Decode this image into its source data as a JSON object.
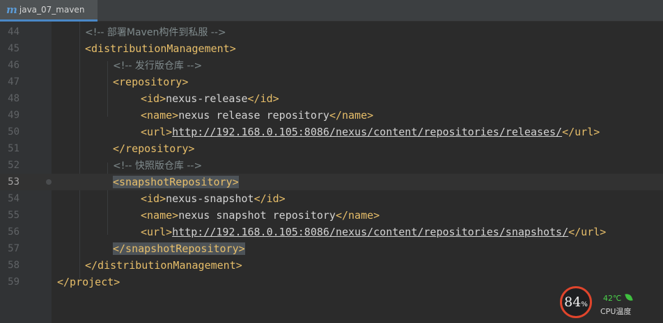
{
  "tab": {
    "icon": "maven-m-icon",
    "icon_glyph": "m",
    "label": "java_07_maven"
  },
  "lines": [
    {
      "n": "44",
      "tokens": [
        {
          "k": "c",
          "v": "<!-- 部署Maven构件到私服 -->"
        }
      ]
    },
    {
      "n": "45",
      "tokens": [
        {
          "k": "t",
          "v": "<distributionManagement>"
        }
      ]
    },
    {
      "n": "46",
      "tokens": [
        {
          "k": "c",
          "v": "<!-- 发行版仓库 -->"
        }
      ]
    },
    {
      "n": "47",
      "tokens": [
        {
          "k": "t",
          "v": "<repository>"
        }
      ]
    },
    {
      "n": "48",
      "tokens": [
        {
          "k": "t",
          "v": "<id>"
        },
        {
          "k": "x",
          "v": "nexus-release"
        },
        {
          "k": "t",
          "v": "</id>"
        }
      ]
    },
    {
      "n": "49",
      "tokens": [
        {
          "k": "t",
          "v": "<name>"
        },
        {
          "k": "x",
          "v": "nexus release repository"
        },
        {
          "k": "t",
          "v": "</name>"
        }
      ]
    },
    {
      "n": "50",
      "tokens": [
        {
          "k": "t",
          "v": "<url>"
        },
        {
          "k": "u",
          "v": "http://192.168.0.105:8086/nexus/content/repositories/releases/"
        },
        {
          "k": "t",
          "v": "</url>"
        }
      ]
    },
    {
      "n": "51",
      "tokens": [
        {
          "k": "t",
          "v": "</repository>"
        }
      ]
    },
    {
      "n": "52",
      "tokens": [
        {
          "k": "c",
          "v": "<!-- 快照版仓库 -->"
        }
      ]
    },
    {
      "n": "53",
      "tokens": [
        {
          "k": "t",
          "v": "<snapshotRepository>",
          "hl": true
        }
      ]
    },
    {
      "n": "54",
      "tokens": [
        {
          "k": "t",
          "v": "<id>"
        },
        {
          "k": "x",
          "v": "nexus-snapshot"
        },
        {
          "k": "t",
          "v": "</id>"
        }
      ]
    },
    {
      "n": "55",
      "tokens": [
        {
          "k": "t",
          "v": "<name>"
        },
        {
          "k": "x",
          "v": "nexus snapshot repository"
        },
        {
          "k": "t",
          "v": "</name>"
        }
      ]
    },
    {
      "n": "56",
      "tokens": [
        {
          "k": "t",
          "v": "<url>"
        },
        {
          "k": "u",
          "v": "http://192.168.0.105:8086/nexus/content/repositories/snapshots/"
        },
        {
          "k": "t",
          "v": "</url>"
        }
      ]
    },
    {
      "n": "57",
      "tokens": [
        {
          "k": "t",
          "v": "</snapshotRepository>",
          "hl": true
        }
      ]
    },
    {
      "n": "58",
      "tokens": [
        {
          "k": "t",
          "v": "</distributionManagement>"
        }
      ]
    },
    {
      "n": "59",
      "tokens": [
        {
          "k": "t",
          "v": "</project>"
        }
      ]
    }
  ],
  "current_line": "53",
  "cpu": {
    "percent": "84",
    "percent_sign": "%",
    "temperature": "42℃",
    "label": "CPU温度",
    "ring_color": "#e0452c",
    "temp_color": "#4bd14b"
  },
  "colors": {
    "tag": "#e8bf6a",
    "text": "#d4d4d4",
    "comment": "#7f8a8c",
    "gutter_number": "#606366",
    "background": "#2b2b2b"
  }
}
